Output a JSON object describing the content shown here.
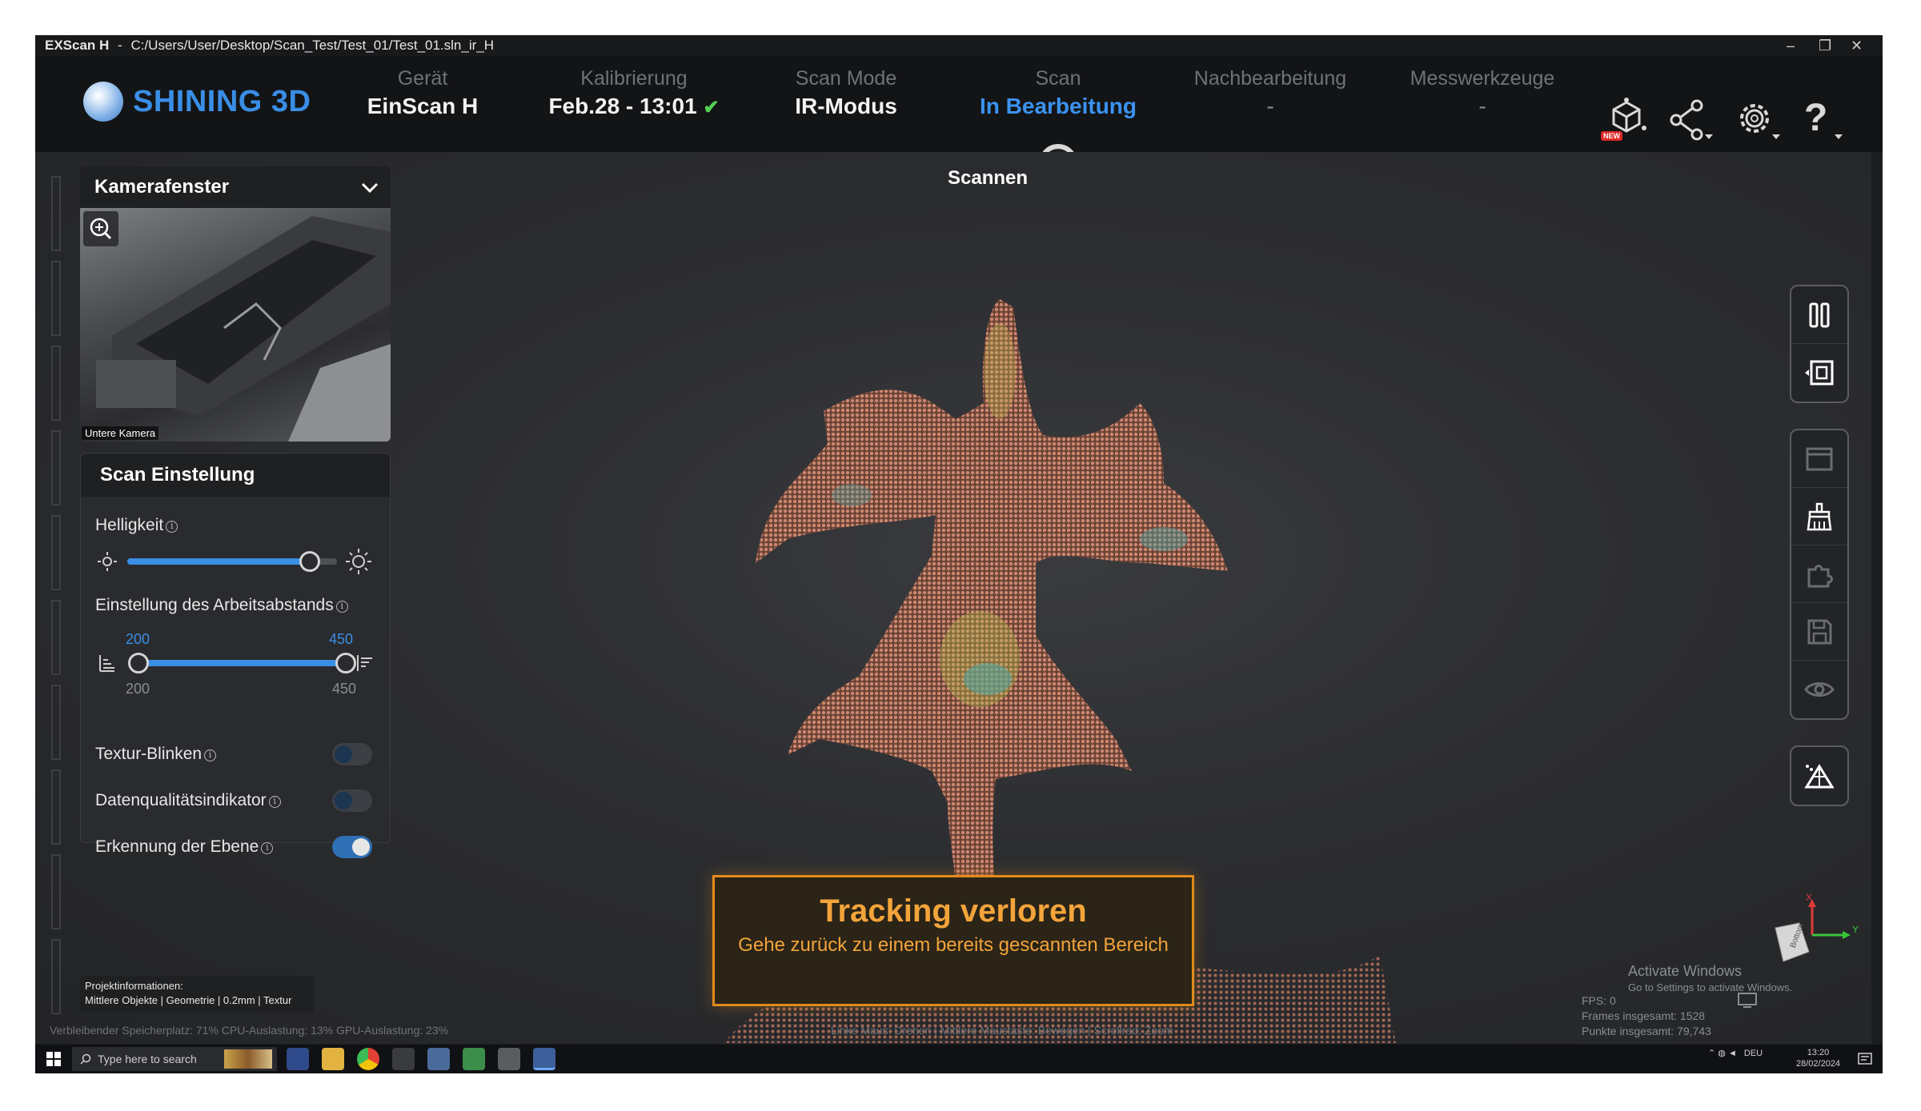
{
  "window": {
    "app_name": "EXScan H",
    "separator": "-",
    "path": "C:/Users/User/Desktop/Scan_Test/Test_01/Test_01.sln_ir_H",
    "minimize": "–",
    "restore": "❐",
    "close": "✕"
  },
  "brand": {
    "name": "SHINING 3D"
  },
  "steps": [
    {
      "label": "Gerät",
      "value": "EinScan H"
    },
    {
      "label": "Kalibrierung",
      "value": "Feb.28 - 13:01",
      "check": "✔"
    },
    {
      "label": "Scan Mode",
      "value": "IR-Modus"
    },
    {
      "label": "Scan",
      "value": "In Bearbeitung"
    },
    {
      "label": "Nachbearbeitung",
      "value": "-"
    },
    {
      "label": "Messwerkzeuge",
      "value": "-"
    }
  ],
  "header_icons": {
    "new_badge": "NEW",
    "help": "?"
  },
  "stage_label": "Scannen",
  "camera": {
    "title": "Kamerafenster",
    "caption": "Untere Kamera"
  },
  "scan_settings": {
    "title": "Scan Einstellung",
    "brightness": {
      "label": "Helligkeit",
      "level": 0.87
    },
    "working_distance": {
      "label": "Einstellung des Arbeitsabstands",
      "min_value": "200",
      "max_value": "450",
      "min_limit": "200",
      "max_limit": "450"
    },
    "texture_flash": {
      "label": "Textur-Blinken",
      "on": false
    },
    "data_quality": {
      "label": "Datenqualitätsindikator",
      "on": false
    },
    "plane_detection": {
      "label": "Erkennung der Ebene",
      "on": true
    },
    "info_glyph": "i"
  },
  "project_info": {
    "title": "Projektinformationen:",
    "details": "Mittlere Objekte | Geometrie | 0.2mm | Textur"
  },
  "status_bar": "Verbleibender Speicherplatz: 71%  CPU-Auslastung: 13%  GPU-Auslastung: 23%",
  "mouse_hint": "Linke Maus: Drehen | Mittlere Maustaste: Bewegen | Scrollrad: Zoom",
  "alert": {
    "title": "Tracking verloren",
    "subtitle": "Gehe zurück zu einem bereits gescannten Bereich"
  },
  "axis": {
    "x": "X",
    "y": "Y",
    "face": "Bottom"
  },
  "activate_windows": {
    "title": "Activate Windows",
    "subtitle": "Go to Settings to activate Windows."
  },
  "stats": {
    "fps": "FPS: 0",
    "frames": "Frames insgesamt: 1528",
    "points": "Punkte insgesamt: 79,743"
  },
  "taskbar": {
    "search_placeholder": "Type here to search",
    "language": "DEU",
    "time": "13:20",
    "date": "28/02/2024"
  },
  "colors": {
    "accent": "#3a8ee6",
    "alert": "#f3a43a",
    "check": "#54d154",
    "point_cloud": "#c9826a"
  }
}
